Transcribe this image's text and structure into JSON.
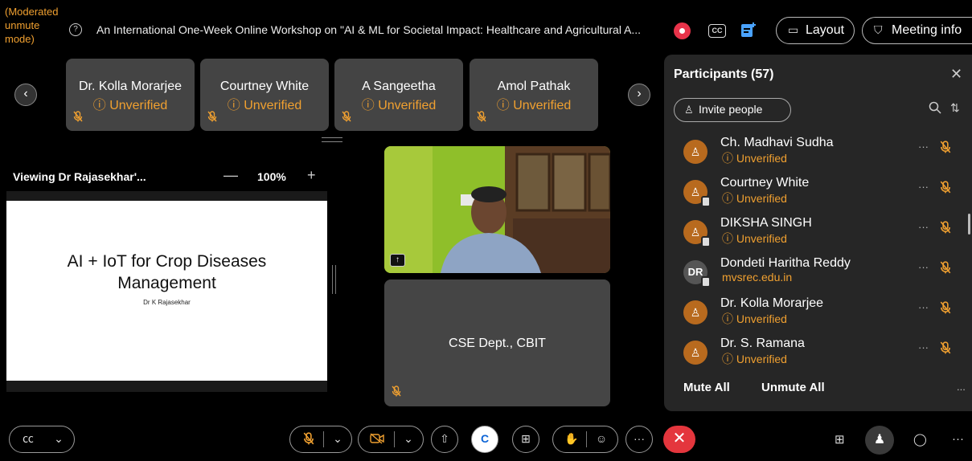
{
  "top_bar": {
    "moderated_text": "(Moderated unmute mode)",
    "meeting_title": "An International One-Week Online Workshop on \"AI & ML for Societal Impact: Healthcare and Agricultural A...",
    "layout_label": "Layout",
    "meeting_info_label": "Meeting info",
    "cc_label": "CC"
  },
  "stage_tiles": [
    {
      "name": "Dr. Kolla Morarjee",
      "status": "Unverified"
    },
    {
      "name": "Courtney White",
      "status": "Unverified"
    },
    {
      "name": "A Sangeetha",
      "status": "Unverified"
    },
    {
      "name": "Amol Pathak",
      "status": "Unverified"
    }
  ],
  "share": {
    "viewing_label": "Viewing Dr Rajasekhar'...",
    "zoom_value": "100%",
    "slide_title": "AI + IoT for Crop Diseases Management",
    "slide_author": "Dr K Rajasekhar"
  },
  "video_tile_name": "CSE Dept., CBIT",
  "participants": {
    "title": "Participants (57)",
    "invite_label": "Invite people",
    "list": [
      {
        "name": "Ch. Madhavi Sudha",
        "status": "Unverified",
        "initials": "",
        "device": false
      },
      {
        "name": "Courtney White",
        "status": "Unverified",
        "initials": "",
        "device": true
      },
      {
        "name": "DIKSHA SINGH",
        "status": "Unverified",
        "initials": "",
        "device": true
      },
      {
        "name": "Dondeti Haritha Reddy",
        "status": "mvsrec.edu.in",
        "initials": "DR",
        "device": true
      },
      {
        "name": "Dr. Kolla Morarjee",
        "status": "Unverified",
        "initials": "",
        "device": false
      },
      {
        "name": "Dr. S. Ramana",
        "status": "Unverified",
        "initials": "",
        "device": false
      }
    ],
    "mute_all_label": "Mute All",
    "unmute_all_label": "Unmute All",
    "more_label": "..."
  },
  "colors": {
    "accent_orange": "#f0a030",
    "end_red": "#e4363d",
    "panel_bg": "#262626",
    "tile_bg": "#444444"
  }
}
